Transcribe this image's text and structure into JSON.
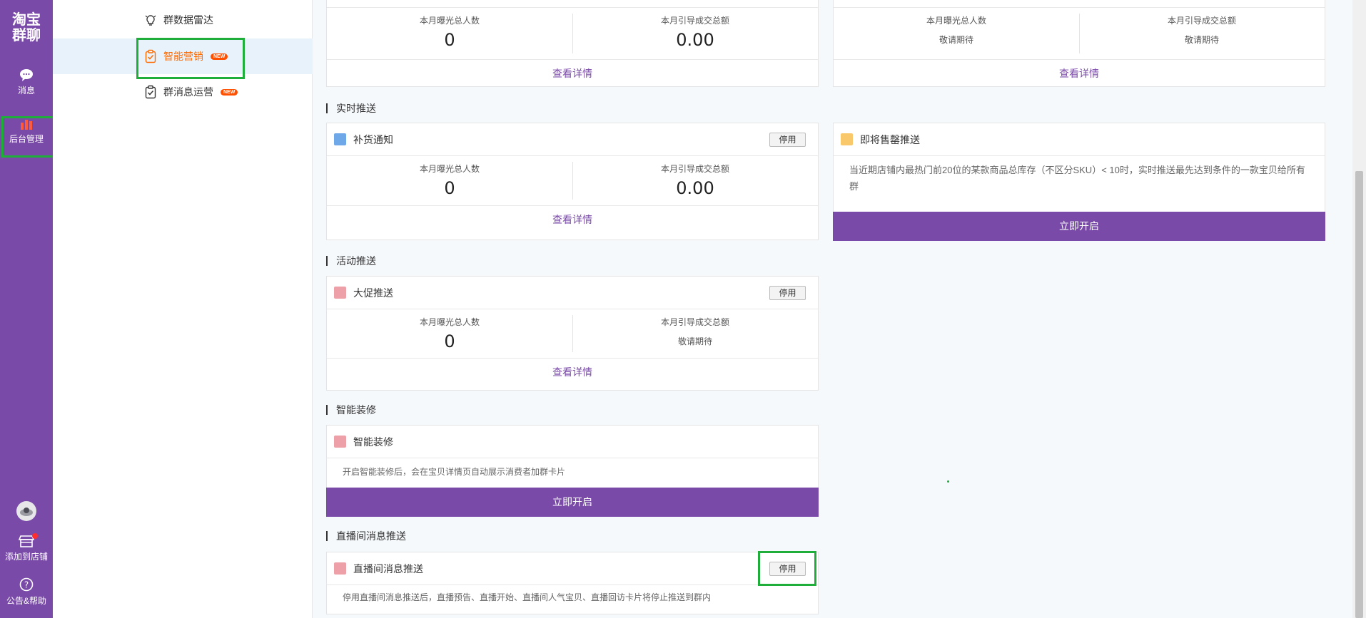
{
  "rail": {
    "logo_line1": "淘宝",
    "logo_line2": "群聊",
    "messages_label": "消息",
    "admin_label": "后台管理",
    "add_shop_label": "添加到店铺",
    "help_label": "公告&帮助"
  },
  "subnav": {
    "items": [
      {
        "label": "群数据雷达",
        "icon": "radar-bulb-icon"
      },
      {
        "label": "智能营销",
        "icon": "clipboard-check-icon",
        "badge": "NEW"
      },
      {
        "label": "群消息运营",
        "icon": "clipboard-check-icon",
        "badge": "NEW"
      }
    ]
  },
  "stats_labels": {
    "exposure": "本月曝光总人数",
    "gmv": "本月引导成交总额"
  },
  "cards": {
    "top_left": {
      "exposure": "0",
      "gmv": "0.00",
      "link": "查看详情"
    },
    "top_right": {
      "exposure": "敬请期待",
      "gmv": "敬请期待",
      "link": "查看详情"
    },
    "restock": {
      "title": "补货通知",
      "button": "停用",
      "exposure": "0",
      "gmv": "0.00",
      "link": "查看详情"
    },
    "soldout": {
      "title": "即将售罄推送",
      "desc": "当近期店铺内最热门前20位的某款商品总库存（不区分SKU）< 10时，实时推送最先达到条件的一款宝贝给所有群",
      "button": "立即开启"
    },
    "promo": {
      "title": "大促推送",
      "button": "停用",
      "exposure": "0",
      "gmv": "敬请期待",
      "link": "查看详情"
    },
    "decor": {
      "title": "智能装修",
      "desc": "开启智能装修后，会在宝贝详情页自动展示消费者加群卡片",
      "button": "立即开启"
    },
    "live": {
      "title": "直播间消息推送",
      "button": "停用",
      "desc": "停用直播间消息推送后，直播预告、直播开始、直播间人气宝贝、直播回访卡片将停止推送到群内"
    }
  },
  "sections": {
    "realtime": "实时推送",
    "activity": "活动推送",
    "decor": "智能装修",
    "live": "直播间消息推送"
  },
  "colors": {
    "rail_bg": "#7a4aa8",
    "accent_orange": "#ff6a00",
    "highlight_green": "#1fae3a",
    "sq_blue": "#6fa8e8",
    "sq_yellow": "#f9c86b",
    "sq_pink": "#eea0a8"
  }
}
